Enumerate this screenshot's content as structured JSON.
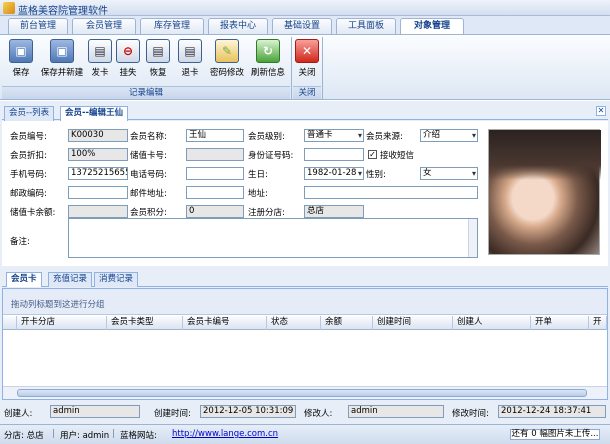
{
  "app": {
    "title": "蓝格美容院管理软件"
  },
  "menu_tabs": [
    "前台管理",
    "会员管理",
    "库存管理",
    "报表中心",
    "基础设置",
    "工具面板",
    "对象管理"
  ],
  "toolbar": {
    "buttons": [
      "保存",
      "保存并新建",
      "发卡",
      "挂失",
      "恢复",
      "退卡",
      "密码修改",
      "刷新信息",
      "关闭"
    ],
    "groups": [
      "记录编辑",
      "关闭"
    ]
  },
  "doc_tabs": [
    "会员--列表",
    "会员--编辑王仙"
  ],
  "form": {
    "member_no_label": "会员编号:",
    "member_no": "K00030",
    "member_name_label": "会员名称:",
    "member_name": "王仙",
    "member_level_label": "会员级别:",
    "member_level": "普通卡",
    "member_source_label": "会员来源:",
    "member_source": "介绍",
    "discount_label": "会员折扣:",
    "discount": "100%",
    "stored_card_label": "储值卡号:",
    "stored_card": "",
    "id_card_label": "身份证号码:",
    "id_card": "",
    "sms_label": "接收短信",
    "sms_checked": true,
    "mobile_label": "手机号码:",
    "mobile": "13725215655",
    "phone_label": "电话号码:",
    "phone": "",
    "birthday_label": "生日:",
    "birthday": "1982-01-28",
    "gender_label": "性别:",
    "gender": "女",
    "zip_label": "邮政编码:",
    "zip": "",
    "email_label": "邮件地址:",
    "email": "",
    "address_label": "地址:",
    "address": "",
    "stored_balance_label": "储值卡余额:",
    "stored_balance": "",
    "points_label": "会员积分:",
    "points": "0",
    "branch_label": "注册分店:",
    "branch": "总店",
    "remark_label": "备注:"
  },
  "sub_tabs": [
    "会员卡",
    "充值记录",
    "消费记录"
  ],
  "grid": {
    "group_hint": "拖动列标题到这进行分组",
    "columns": [
      "开卡分店",
      "会员卡类型",
      "会员卡编号",
      "状态",
      "余额",
      "创建时间",
      "创建人",
      "开单",
      "开"
    ]
  },
  "footer": {
    "creator_label": "创建人:",
    "creator": "admin",
    "created_time_label": "创建时间:",
    "created_time": "2012-12-05  10:31:09",
    "modifier_label": "修改人:",
    "modifier": "admin",
    "modified_time_label": "修改时间:",
    "modified_time": "2012-12-24  18:37:41"
  },
  "status": {
    "branch": "分店: 总店",
    "user": "用户: admin",
    "site_label": "蓝格网站:",
    "site_url": "http://www.lange.com.cn",
    "upload": "还有 0 幅图片未上传..."
  }
}
